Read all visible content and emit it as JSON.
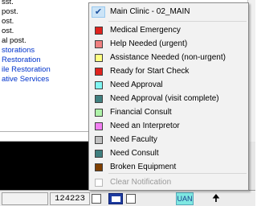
{
  "background": {
    "lines": [
      {
        "text": "sst.",
        "color": "black"
      },
      {
        "text": "post.",
        "color": "black"
      },
      {
        "text": "ost.",
        "color": "black"
      },
      {
        "text": "ost.",
        "color": "black"
      },
      {
        "text": "al post.",
        "color": "black"
      },
      {
        "text": "storations",
        "color": "blue"
      },
      {
        "text": "Restoration",
        "color": "blue"
      },
      {
        "text": "ile Restoration",
        "color": "blue"
      },
      {
        "text": "ative Services",
        "color": "blue"
      }
    ]
  },
  "menu": {
    "header": {
      "label": "Main Clinic - 02_MAIN",
      "checked": true
    },
    "items": [
      {
        "label": "Medical Emergency",
        "color": "#e0231e"
      },
      {
        "label": "Help Needed (urgent)",
        "color": "#f08080"
      },
      {
        "label": "Assistance Needed (non-urgent)",
        "color": "#ffff80"
      },
      {
        "label": "Ready for Start Check",
        "color": "#e0231e"
      },
      {
        "label": "Need Approval",
        "color": "#7ff6f2"
      },
      {
        "label": "Need Approval (visit complete)",
        "color": "#3f7f7f"
      },
      {
        "label": "Financial Consult",
        "color": "#aef2a8"
      },
      {
        "label": "Need an Interpretor",
        "color": "#f27ff2"
      },
      {
        "label": "Need Faculty",
        "color": "#c0c0c0"
      },
      {
        "label": "Need Consult",
        "color": "#3f7f7f"
      },
      {
        "label": "Broken Equipment",
        "color": "#7f3f00"
      }
    ],
    "footer": {
      "label": "Clear Notification",
      "disabled": true
    }
  },
  "status_bar": {
    "number": "124223",
    "uan_label": "UAN",
    "arrow": "🠉"
  }
}
